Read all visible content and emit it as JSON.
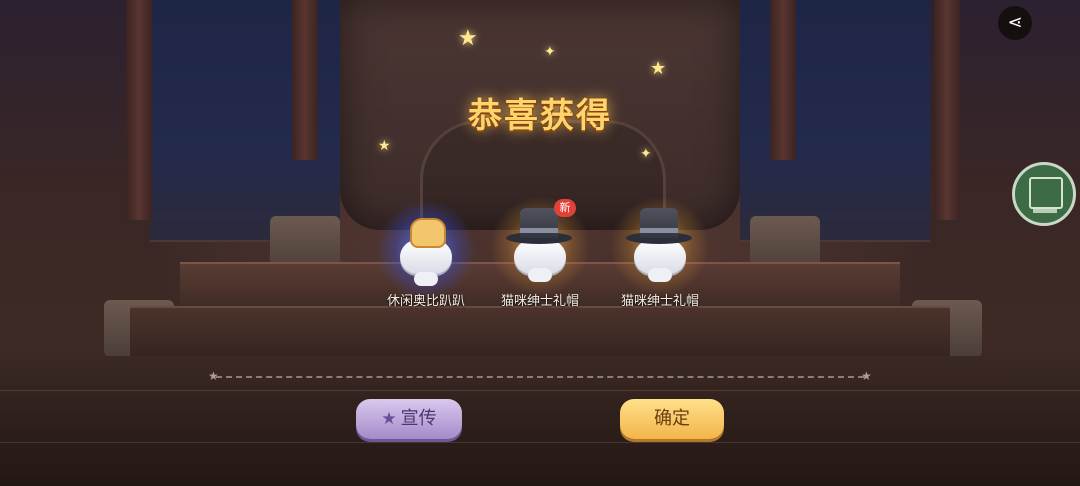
{
  "header": {
    "title": "恭喜获得"
  },
  "toolbar": {
    "share_icon": "share-icon"
  },
  "side_widget": {
    "icon": "book-icon"
  },
  "rewards": [
    {
      "name": "休闲奥比趴趴",
      "rarity_color": "#4a5cf0",
      "is_new": false
    },
    {
      "name": "猫咪绅士礼帽",
      "rarity_color": "#f2b54a",
      "is_new": true
    },
    {
      "name": "猫咪绅士礼帽",
      "rarity_color": "#f2b54a",
      "is_new": false
    }
  ],
  "new_badge_label": "新",
  "buttons": {
    "promote_label": "宣传",
    "confirm_label": "确定"
  },
  "colors": {
    "title_gold": "#ffd56a",
    "promote_purple": "#a48bc9",
    "confirm_gold": "#f2b54a"
  }
}
